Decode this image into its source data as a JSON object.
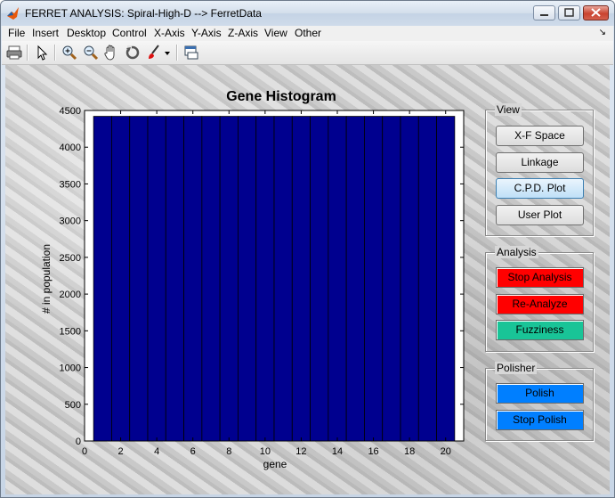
{
  "window": {
    "title": "FERRET ANALYSIS: Spiral-High-D --> FerretData"
  },
  "menu": [
    "File",
    "Insert",
    "Desktop",
    "Control",
    "X-Axis",
    "Y-Axis",
    "Z-Axis",
    "View",
    "Other"
  ],
  "toolbar": {
    "icons": [
      "print-icon",
      "pointer-icon",
      "zoom-in-icon",
      "zoom-out-icon",
      "pan-hand-icon",
      "rotate-icon",
      "brush-icon",
      "dropdown-arrow-icon",
      "plot-tools-icon"
    ]
  },
  "chart_data": {
    "type": "bar",
    "title": "Gene Histogram",
    "xlabel": "gene",
    "ylabel": "# in population",
    "categories": [
      1,
      2,
      3,
      4,
      5,
      6,
      7,
      8,
      9,
      10,
      11,
      12,
      13,
      14,
      15,
      16,
      17,
      18,
      19,
      20
    ],
    "values": [
      4420,
      4420,
      4420,
      4420,
      4420,
      4420,
      4420,
      4420,
      4420,
      4420,
      4420,
      4420,
      4420,
      4420,
      4420,
      4420,
      4420,
      4420,
      4420,
      4420
    ],
    "xlim": [
      0,
      21
    ],
    "ylim": [
      0,
      4500
    ],
    "xticks": [
      "0",
      "2",
      "4",
      "6",
      "8",
      "10",
      "12",
      "14",
      "16",
      "18",
      "20"
    ],
    "yticks": [
      "0",
      "500",
      "1000",
      "1500",
      "2000",
      "2500",
      "3000",
      "3500",
      "4000",
      "4500"
    ],
    "bar_color": "#00008f",
    "grid": false
  },
  "panels": {
    "view": {
      "label": "View",
      "buttons": [
        "X-F Space",
        "Linkage",
        "C.P.D. Plot",
        "User Plot"
      ]
    },
    "analysis": {
      "label": "Analysis",
      "buttons": [
        "Stop Analysis",
        "Re-Analyze",
        "Fuzziness"
      ]
    },
    "polisher": {
      "label": "Polisher",
      "buttons": [
        "Polish",
        "Stop Polish"
      ]
    }
  },
  "colors": {
    "stop_analysis": "#ff0000",
    "re_analyze": "#ff0000",
    "fuzziness": "#19c497",
    "polish": "#007fff",
    "stop_polish": "#007fff"
  }
}
